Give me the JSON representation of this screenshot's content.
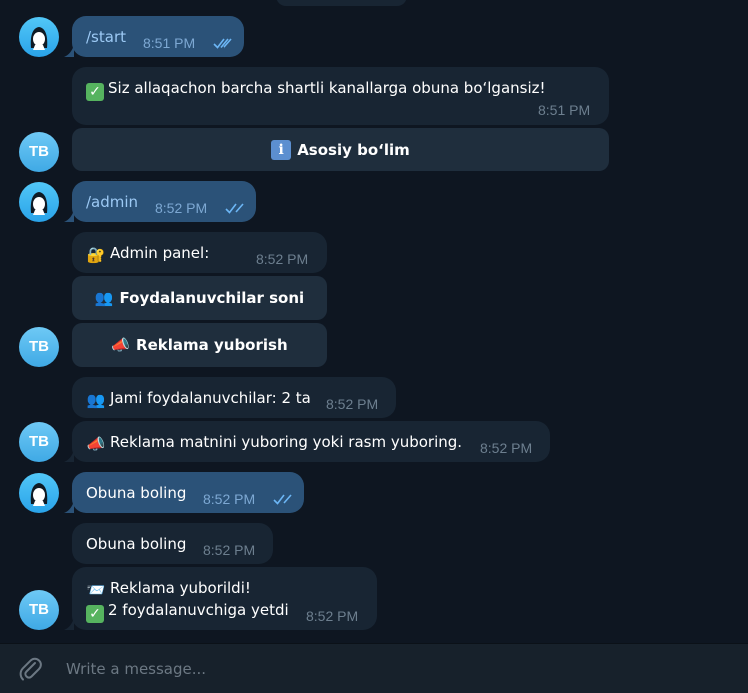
{
  "chat": {
    "bot_avatar_initials": "TB",
    "messages": {
      "m1": {
        "text": "/start",
        "time": "8:51 PM"
      },
      "m2": {
        "text": "Siz allaqachon barcha shartli kanallarga obuna bo‘lgansiz!",
        "time": "8:51 PM",
        "button": "Asosiy bo‘lim"
      },
      "m3": {
        "text": "/admin",
        "time": "8:52 PM"
      },
      "m4": {
        "text": "Admin panel:",
        "time": "8:52 PM",
        "buttons": [
          "Foydalanuvchilar soni",
          "Reklama yuborish"
        ]
      },
      "m5": {
        "text": "Jami foydalanuvchilar: 2 ta",
        "time": "8:52 PM"
      },
      "m6": {
        "text": "Reklama matnini yuboring yoki rasm yuboring.",
        "time": "8:52 PM"
      },
      "m7": {
        "text": "Obuna boling",
        "time": "8:52 PM"
      },
      "m8": {
        "text": "Obuna boling",
        "time": "8:52 PM"
      },
      "m9": {
        "line1": "Reklama yuborildi!",
        "line2": "2 foydalanuvchiga yetdi",
        "time": "8:52 PM"
      }
    }
  },
  "icons": {
    "check": "check-mark-emoji",
    "info": "information-emoji",
    "lock": "locked-with-key-emoji",
    "users": "busts-emoji",
    "megaphone": "megaphone-emoji",
    "envelope": "envelope-emoji",
    "read": "double-check-icon",
    "attach": "paperclip-icon"
  },
  "colors": {
    "background": "#0e1621",
    "outgoing_bubble": "#2b5278",
    "incoming_bubble": "#182533",
    "keyboard_button": "#1f2e3d",
    "composer": "#17212b",
    "read_ticks": "#6cb6f5"
  },
  "composer": {
    "placeholder": "Write a message..."
  }
}
